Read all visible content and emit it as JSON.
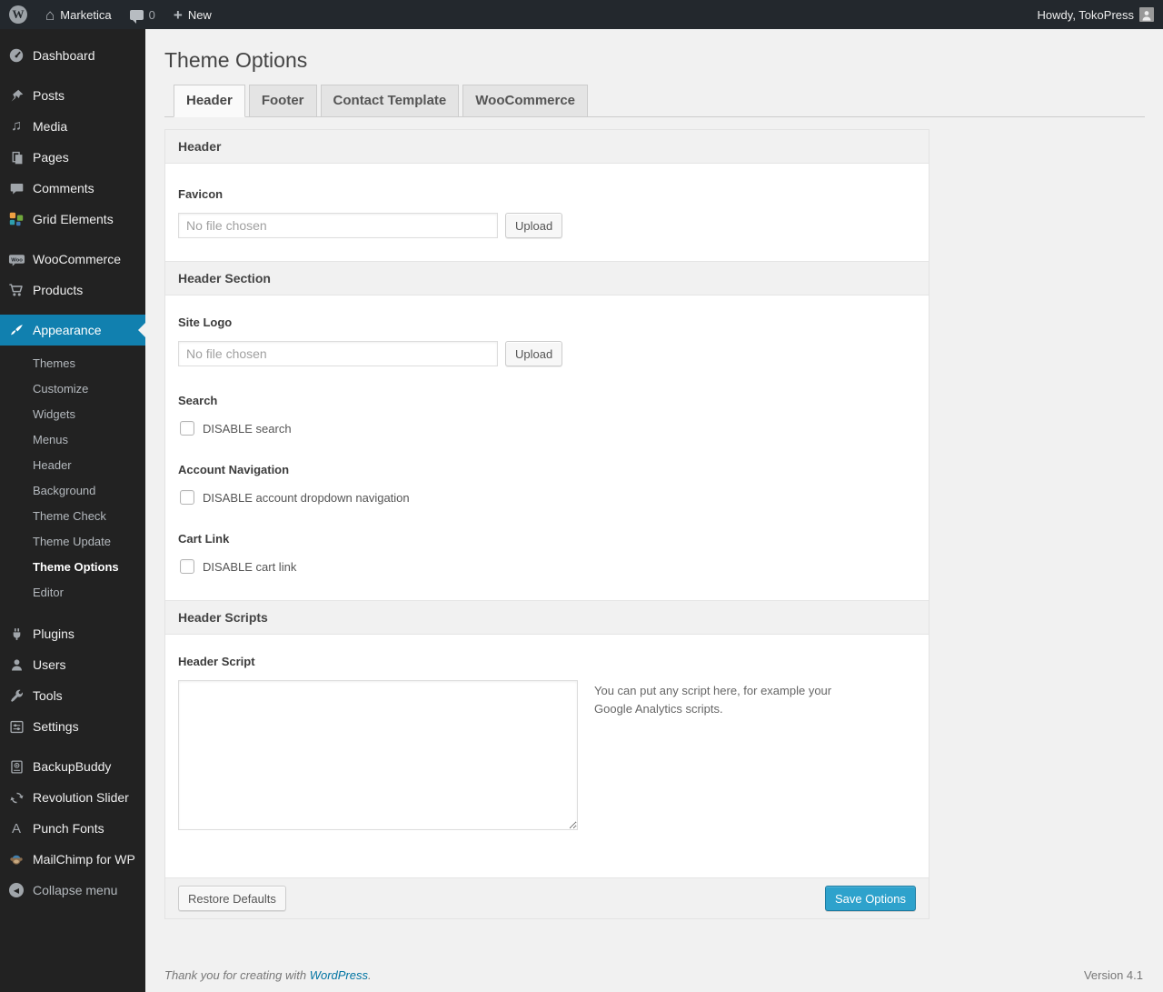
{
  "admin_bar": {
    "site_name": "Marketica",
    "comment_count": "0",
    "new_label": "New",
    "howdy_text": "Howdy, TokoPress"
  },
  "sidebar": {
    "items": [
      {
        "label": "Dashboard"
      },
      {
        "label": "Posts"
      },
      {
        "label": "Media"
      },
      {
        "label": "Pages"
      },
      {
        "label": "Comments"
      },
      {
        "label": "Grid Elements"
      },
      {
        "label": "WooCommerce"
      },
      {
        "label": "Products"
      },
      {
        "label": "Appearance"
      },
      {
        "label": "Plugins"
      },
      {
        "label": "Users"
      },
      {
        "label": "Tools"
      },
      {
        "label": "Settings"
      },
      {
        "label": "BackupBuddy"
      },
      {
        "label": "Revolution Slider"
      },
      {
        "label": "Punch Fonts"
      },
      {
        "label": "MailChimp for WP"
      },
      {
        "label": "Collapse menu"
      }
    ],
    "active_item": "Appearance",
    "appearance_submenu": [
      "Themes",
      "Customize",
      "Widgets",
      "Menus",
      "Header",
      "Background",
      "Theme Check",
      "Theme Update",
      "Theme Options",
      "Editor"
    ],
    "active_submenu_item": "Theme Options"
  },
  "main": {
    "page_title": "Theme Options",
    "tabs": [
      "Header",
      "Footer",
      "Contact Template",
      "WooCommerce"
    ],
    "active_tab": "Header",
    "sections": {
      "header_title": "Header",
      "header_section_title": "Header Section",
      "header_scripts_title": "Header Scripts"
    },
    "fields": {
      "favicon_label": "Favicon",
      "favicon_value": "",
      "favicon_placeholder": "No file chosen",
      "favicon_upload_label": "Upload",
      "site_logo_label": "Site Logo",
      "site_logo_value": "",
      "site_logo_placeholder": "No file chosen",
      "site_logo_upload_label": "Upload",
      "search_label": "Search",
      "search_checkbox_label": "DISABLE search",
      "search_checked": false,
      "account_nav_label": "Account Navigation",
      "account_nav_checkbox_label": "DISABLE account dropdown navigation",
      "account_nav_checked": false,
      "cart_link_label": "Cart Link",
      "cart_link_checkbox_label": "DISABLE cart link",
      "cart_link_checked": false,
      "header_script_label": "Header Script",
      "header_script_value": "",
      "header_script_help": "You can put any script here, for example your Google Analytics scripts."
    },
    "actions": {
      "restore_defaults_label": "Restore Defaults",
      "save_options_label": "Save Options"
    }
  },
  "footer": {
    "thanks_text": "Thank you for creating with",
    "wordpress_link_label": "WordPress",
    "thanks_period": ".",
    "version_text": "Version 4.1"
  },
  "icons": {
    "wordpress_logo": "W",
    "home": "⌂",
    "plus": "+",
    "media_note": "♫",
    "punch_fonts_letter": "A",
    "collapse_arrow": "◀"
  },
  "colors": {
    "menu_highlight": "#1180af",
    "button_primary": "#2ea2cc",
    "button_primary_border": "#1b7aa0",
    "link": "#0074a2"
  }
}
